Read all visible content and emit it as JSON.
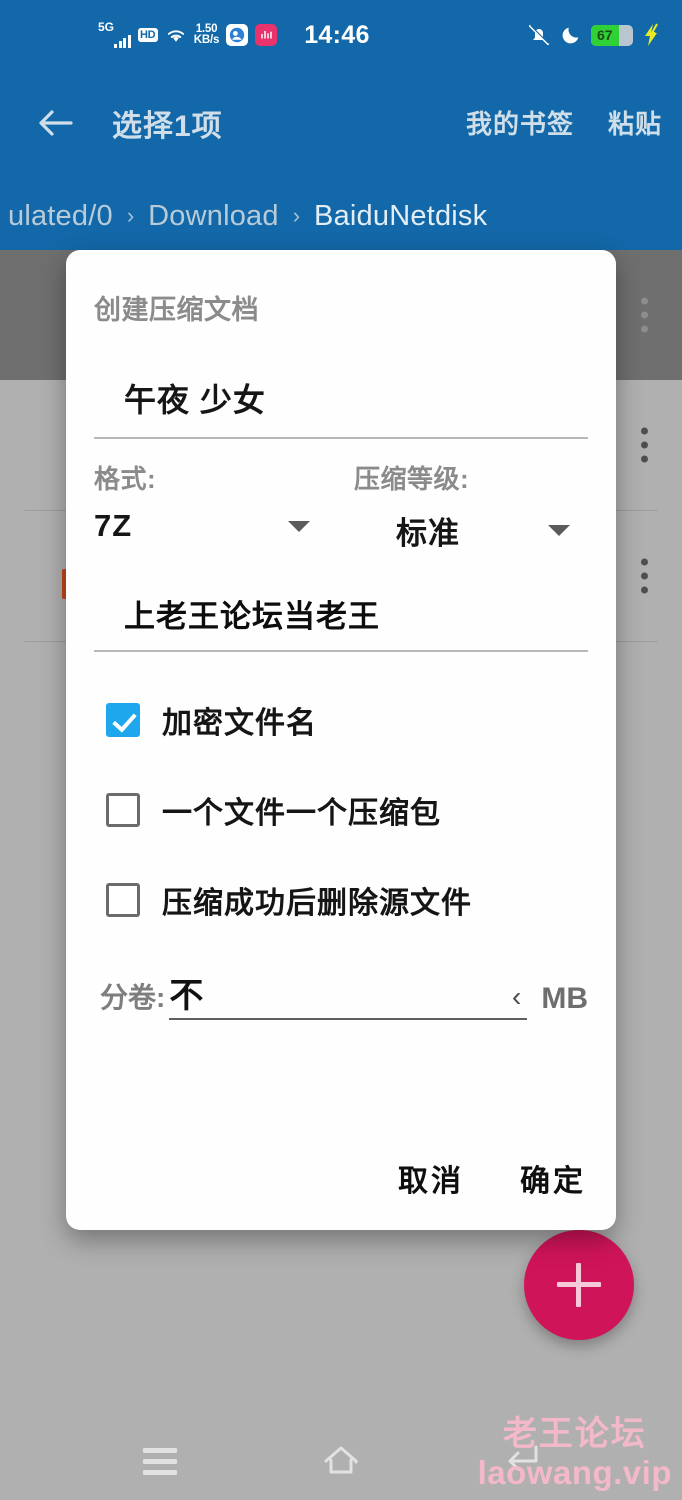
{
  "status_bar": {
    "network_label": "5G",
    "hd_label": "HD",
    "wifi_icon": "wifi-icon",
    "net_speed_value": "1.50",
    "net_speed_unit": "KB/s",
    "app_icon_1": "cloud-app-icon",
    "app_icon_2": "music-app-icon",
    "time": "14:46",
    "mute_icon": "bell-muted-icon",
    "dnd_icon": "moon-icon",
    "battery_percent": "67",
    "battery_level": 67,
    "charging_icon": "lightning-bolt-icon",
    "battery_color": "#2fd136"
  },
  "action_bar": {
    "back_icon": "arrow-left-icon",
    "title": "选择1项",
    "bookmarks_label": "我的书签",
    "paste_label": "粘贴",
    "background_color": "#1268a8"
  },
  "breadcrumb": {
    "items": [
      {
        "label": "ulated/0",
        "current": false
      },
      {
        "label": "Download",
        "current": false
      },
      {
        "label": "BaiduNetdisk",
        "current": true
      }
    ],
    "separator": "›"
  },
  "file_list": {
    "rows": [
      {
        "icon": "folder-icon",
        "selected": true
      },
      {
        "icon": "folder-icon",
        "selected": false
      },
      {
        "icon": "archive-file-icon",
        "selected": false
      }
    ]
  },
  "fab": {
    "icon": "plus-icon",
    "color": "#d01459"
  },
  "nav_bar": {
    "recents_icon": "hamburger-menu-icon",
    "home_icon": "home-icon",
    "back_icon": "back-arrow-icon"
  },
  "watermark": {
    "line1": "老王论坛",
    "line2": "laowang.vip",
    "color": "#f4b9c8"
  },
  "dialog": {
    "title": "创建压缩文档",
    "archive_name": "午夜 少女",
    "format": {
      "label": "格式:",
      "value": "7Z",
      "caret_icon": "chevron-down-icon"
    },
    "level": {
      "label": "压缩等级:",
      "value": "标准",
      "caret_icon": "chevron-down-icon"
    },
    "password": "上老王论坛当老王",
    "checkboxes": [
      {
        "label": "加密文件名",
        "checked": true
      },
      {
        "label": "一个文件一个压缩包",
        "checked": false
      },
      {
        "label": "压缩成功后删除源文件",
        "checked": false
      }
    ],
    "split": {
      "label": "分卷:",
      "value": "不",
      "chevron_icon": "chevron-left-icon",
      "unit": "MB"
    },
    "cancel_label": "取消",
    "ok_label": "确定",
    "accent_color": "#1ea7ec"
  }
}
